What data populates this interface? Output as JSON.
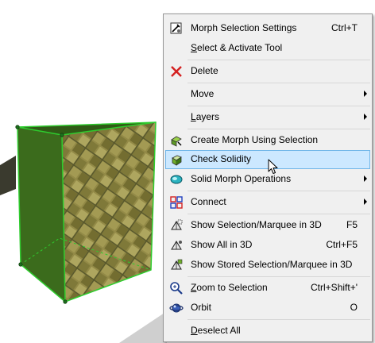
{
  "context_menu": {
    "items": [
      {
        "label": "Morph Selection Settings",
        "shortcut": "Ctrl+T",
        "icon": "morph-settings-icon"
      },
      {
        "label_u": "S",
        "label_rest": "elect & Activate Tool"
      },
      {
        "label": "Delete",
        "icon": "delete-x-icon"
      },
      {
        "label": "Move",
        "submenu": true
      },
      {
        "label_u": "L",
        "label_rest": "ayers",
        "submenu": true
      },
      {
        "label": "Create Morph Using Selection",
        "icon": "create-morph-icon"
      },
      {
        "label": "Check Solidity",
        "icon": "check-solidity-icon",
        "highlighted": true
      },
      {
        "label": "Solid Morph Operations",
        "icon": "solid-operations-icon",
        "submenu": true
      },
      {
        "label": "Connect",
        "icon": "connect-icon",
        "submenu": true
      },
      {
        "label": "Show Selection/Marquee in 3D",
        "shortcut": "F5",
        "icon": "show-selection-3d-icon"
      },
      {
        "label": "Show All in 3D",
        "shortcut": "Ctrl+F5",
        "icon": "show-all-3d-icon"
      },
      {
        "label": "Show Stored Selection/Marquee in 3D",
        "icon": "show-stored-3d-icon"
      },
      {
        "label_u": "Z",
        "label_rest": "oom to Selection",
        "shortcut": "Ctrl+Shift+'",
        "icon": "zoom-selection-icon"
      },
      {
        "label": "Orbit",
        "shortcut": "O",
        "icon": "orbit-icon"
      },
      {
        "label_u": "D",
        "label_rest": "eselect All"
      }
    ]
  },
  "colors": {
    "menu_bg": "#f0f0f0",
    "highlight_bg": "#cce8ff",
    "highlight_border": "#6fb5e8",
    "selection_green": "#2ecc2e",
    "morph_face_dark": "#2f5a16"
  }
}
